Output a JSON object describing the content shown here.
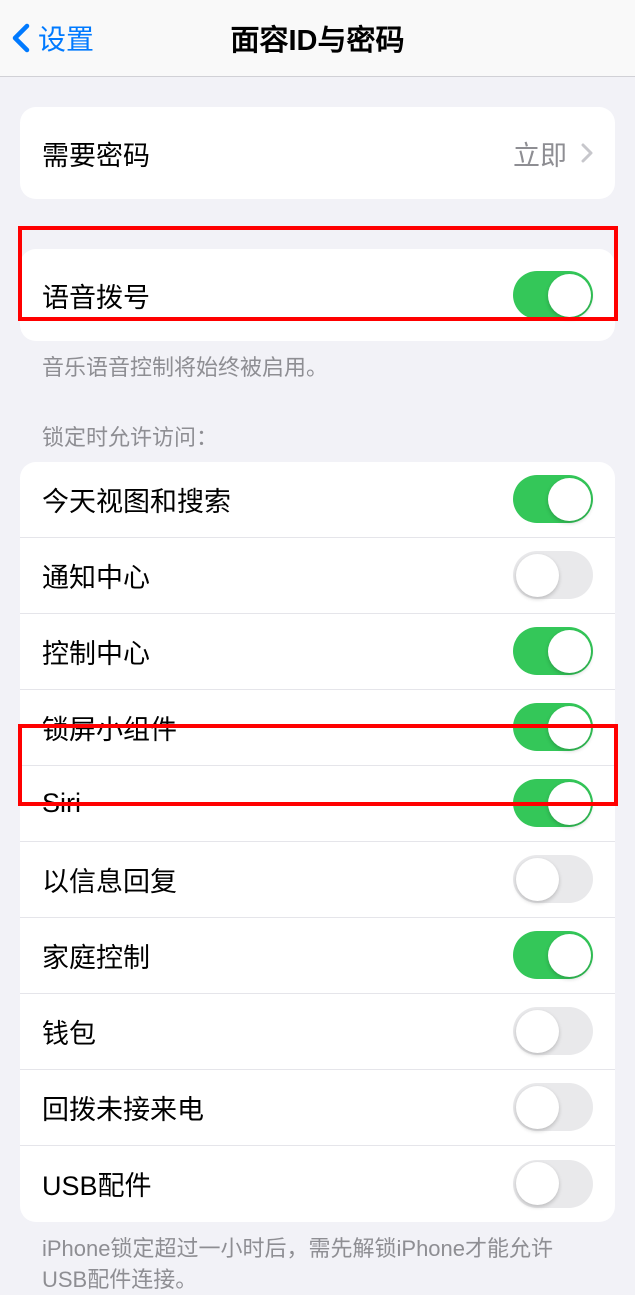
{
  "navbar": {
    "back_label": "设置",
    "title": "面容ID与密码"
  },
  "require_passcode": {
    "label": "需要密码",
    "value": "立即"
  },
  "voice_dial": {
    "label": "语音拨号",
    "footer": "音乐语音控制将始终被启用。"
  },
  "lock_access": {
    "header": "锁定时允许访问：",
    "items": [
      {
        "label": "今天视图和搜索",
        "on": true
      },
      {
        "label": "通知中心",
        "on": false
      },
      {
        "label": "控制中心",
        "on": true
      },
      {
        "label": "锁屏小组件",
        "on": true
      },
      {
        "label": "Siri",
        "on": true
      },
      {
        "label": "以信息回复",
        "on": false
      },
      {
        "label": "家庭控制",
        "on": true
      },
      {
        "label": "钱包",
        "on": false
      },
      {
        "label": "回拨未接来电",
        "on": false
      },
      {
        "label": "USB配件",
        "on": false
      }
    ],
    "footer": "iPhone锁定超过一小时后，需先解锁iPhone才能允许USB配件连接。"
  }
}
